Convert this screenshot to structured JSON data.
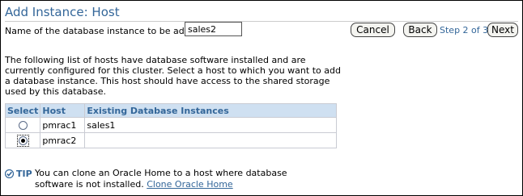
{
  "header": {
    "title": "Add Instance: Host"
  },
  "form": {
    "instance_label": "Name of the database instance to be added",
    "instance_value": "sales2"
  },
  "buttons": {
    "cancel": "Cancel",
    "back": "Back",
    "next": "Next"
  },
  "step": "Step 2 of 3",
  "description": "The following list of hosts have database software installed and are currently configured for this cluster. Select a host to which you want to add a database instance. This host should have access to the shared storage used by this database.",
  "table": {
    "headers": {
      "select": "Select",
      "host": "Host",
      "instances": "Existing Database Instances"
    },
    "rows": [
      {
        "host": "pmrac1",
        "instances": "sales1",
        "selected": false
      },
      {
        "host": "pmrac2",
        "instances": "",
        "selected": true
      }
    ]
  },
  "tip": {
    "label": "TIP",
    "text": "You can clone an Oracle Home to a host where database software is not installed.",
    "link": "Clone Oracle Home"
  },
  "colors": {
    "accent": "#336699",
    "header_bg": "#cfe0f1"
  }
}
